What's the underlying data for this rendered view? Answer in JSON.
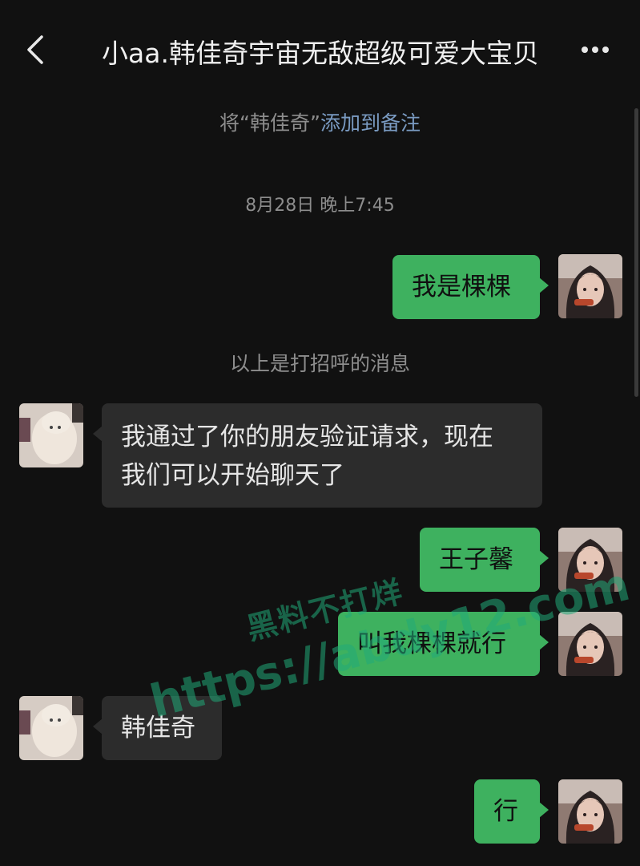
{
  "header": {
    "title": "小aa.韩佳奇宇宙无敌超级可爱大宝贝",
    "back_icon": "chevron-left-icon",
    "more_icon": "more-horizontal-icon"
  },
  "remark_tip": {
    "prefix": "将“韩佳奇”",
    "link": "添加到备注"
  },
  "timestamp": "8月28日 晚上7:45",
  "greeting_notice": "以上是打招呼的消息",
  "messages": [
    {
      "from": "me",
      "text": "我是棵棵"
    },
    {
      "from": "other",
      "lines": [
        "我通过了你的朋友验证请求，现在",
        "我们可以开始聊天了"
      ]
    },
    {
      "from": "me",
      "text": "王子馨"
    },
    {
      "from": "me",
      "text": "叫我棵棵就行"
    },
    {
      "from": "other",
      "text": "韩佳奇"
    },
    {
      "from": "me",
      "text": "行"
    }
  ],
  "watermark": {
    "line1": "黑料不打烊",
    "line2": "https://abdy12.com"
  },
  "colors": {
    "background": "#111111",
    "outgoing_bubble": "#3eb15f",
    "incoming_bubble": "#2c2c2c",
    "link": "#7a9bc2",
    "watermark": "#21aa78"
  }
}
